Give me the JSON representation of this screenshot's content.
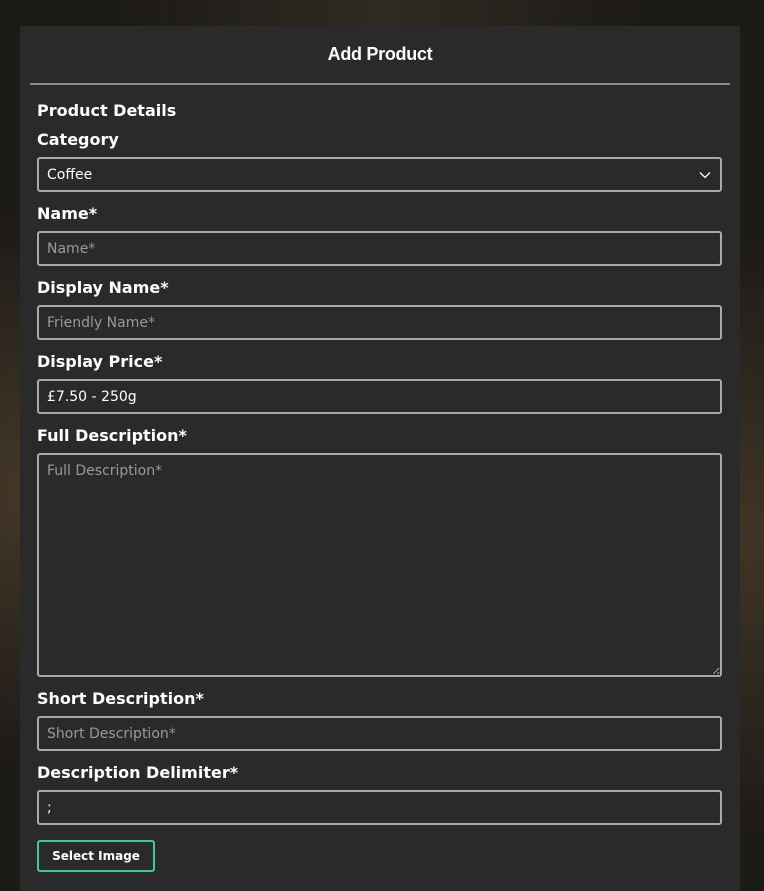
{
  "header": {
    "title": "Add Product"
  },
  "form": {
    "section_title": "Product Details",
    "category": {
      "label": "Category",
      "value": "Coffee"
    },
    "name": {
      "label": "Name*",
      "value": "",
      "placeholder": "Name*"
    },
    "display_name": {
      "label": "Display Name*",
      "value": "",
      "placeholder": "Friendly Name*"
    },
    "display_price": {
      "label": "Display Price*",
      "value": "£7.50 - 250g",
      "placeholder": ""
    },
    "full_description": {
      "label": "Full Description*",
      "value": "",
      "placeholder": "Full Description*"
    },
    "short_description": {
      "label": "Short Description*",
      "value": "",
      "placeholder": "Short Description*"
    },
    "description_delimiter": {
      "label": "Description Delimiter*",
      "value": ";",
      "placeholder": ""
    },
    "select_image_label": "Select Image"
  },
  "colors": {
    "panel_background": "#2a2a2a",
    "field_border": "#a9a9a9",
    "accent_button_border": "#38c9a0",
    "text": "#ffffff"
  },
  "icons": {
    "select_chevron": "chevron-down-icon"
  }
}
